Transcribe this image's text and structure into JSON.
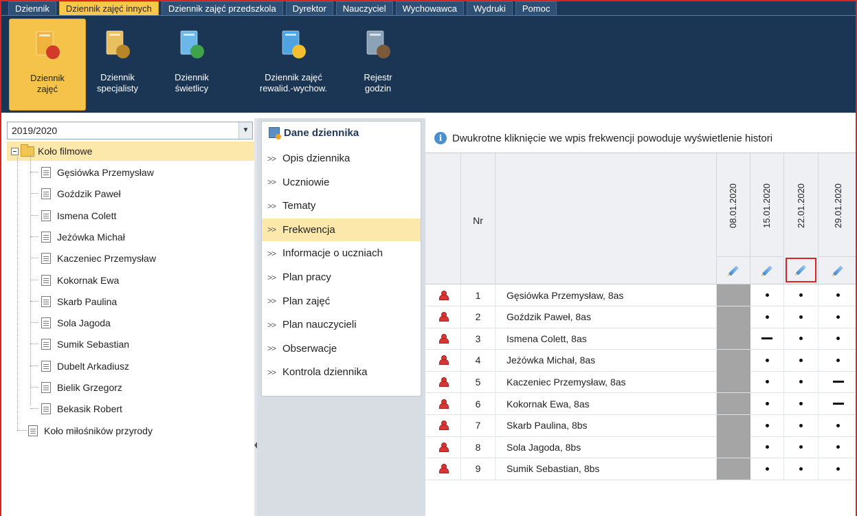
{
  "menu": {
    "tabs": [
      {
        "label": "Dziennik",
        "active": false
      },
      {
        "label": "Dziennik zajęć innych",
        "active": true
      },
      {
        "label": "Dziennik zajęć przedszkola",
        "active": false
      },
      {
        "label": "Dyrektor",
        "active": false
      },
      {
        "label": "Nauczyciel",
        "active": false
      },
      {
        "label": "Wychowawca",
        "active": false
      },
      {
        "label": "Wydruki",
        "active": false
      },
      {
        "label": "Pomoc",
        "active": false
      }
    ]
  },
  "ribbon": {
    "buttons": [
      {
        "label": "Dziennik\nzajęć",
        "icon": "journal-classes-icon",
        "active": true
      },
      {
        "label": "Dziennik\nspecjalisty",
        "icon": "specialist-icon",
        "active": false
      },
      {
        "label": "Dziennik\nświetlicy",
        "icon": "common-room-icon",
        "active": false
      },
      {
        "label": "Dziennik zajęć\nrewalid.-wychow.",
        "icon": "revalidation-icon",
        "active": false
      },
      {
        "label": "Rejestr\ngodzin",
        "icon": "hours-register-icon",
        "active": false
      }
    ]
  },
  "year_select": {
    "value": "2019/2020"
  },
  "tree": {
    "groups": [
      {
        "label": "Koło filmowe",
        "expanded": true,
        "selected": true,
        "children": [
          "Gęsiówka Przemysław",
          "Goździk Paweł",
          "Ismena Colett",
          "Jeżówka Michał",
          "Kaczeniec Przemysław",
          "Kokornak Ewa",
          "Skarb Paulina",
          "Sola Jagoda",
          "Sumik Sebastian",
          "Dubelt Arkadiusz",
          "Bielik Grzegorz",
          "Bekasik Robert"
        ]
      },
      {
        "label": "Koło miłośników przyrody",
        "expanded": false,
        "selected": false,
        "children": []
      }
    ]
  },
  "journal_panel": {
    "title": "Dane dziennika",
    "items": [
      {
        "label": "Opis dziennika",
        "active": false
      },
      {
        "label": "Uczniowie",
        "active": false
      },
      {
        "label": "Tematy",
        "active": false
      },
      {
        "label": "Frekwencja",
        "active": true
      },
      {
        "label": "Informacje o uczniach",
        "active": false
      },
      {
        "label": "Plan pracy",
        "active": false
      },
      {
        "label": "Plan zajęć",
        "active": false
      },
      {
        "label": "Plan nauczycieli",
        "active": false
      },
      {
        "label": "Obserwacje",
        "active": false
      },
      {
        "label": "Kontrola dziennika",
        "active": false
      }
    ]
  },
  "info": {
    "text": "Dwukrotne kliknięcie we wpis frekwencji powoduje wyświetlenie histori"
  },
  "attendance": {
    "nr_header": "Nr",
    "dates": [
      "08.01.2020",
      "15.01.2020",
      "22.01.2020",
      "29.01.2020"
    ],
    "highlighted_date_index": 2,
    "rows": [
      {
        "nr": "1",
        "name": "Gęsiówka Przemysław, 8as",
        "marks": [
          "none",
          "dot",
          "dot",
          "dot"
        ]
      },
      {
        "nr": "2",
        "name": "Goździk Paweł, 8as",
        "marks": [
          "none",
          "dot",
          "dot",
          "dot"
        ]
      },
      {
        "nr": "3",
        "name": "Ismena Colett, 8as",
        "marks": [
          "none",
          "dash",
          "dot",
          "dot"
        ]
      },
      {
        "nr": "4",
        "name": "Jeżówka Michał, 8as",
        "marks": [
          "none",
          "dot",
          "dot",
          "dot"
        ]
      },
      {
        "nr": "5",
        "name": "Kaczeniec Przemysław, 8as",
        "marks": [
          "none",
          "dot",
          "dot",
          "dash"
        ]
      },
      {
        "nr": "6",
        "name": "Kokornak Ewa, 8as",
        "marks": [
          "none",
          "dot",
          "dot",
          "dash"
        ]
      },
      {
        "nr": "7",
        "name": "Skarb Paulina, 8bs",
        "marks": [
          "none",
          "dot",
          "dot",
          "dot"
        ]
      },
      {
        "nr": "8",
        "name": "Sola Jagoda, 8bs",
        "marks": [
          "none",
          "dot",
          "dot",
          "dot"
        ]
      },
      {
        "nr": "9",
        "name": "Sumik Sebastian, 8bs",
        "marks": [
          "none",
          "dot",
          "dot",
          "dot"
        ]
      }
    ]
  },
  "colors": {
    "menu_bg": "#1e3a5a",
    "active_tab": "#f7c84a",
    "selection": "#fde8ab",
    "highlight_border": "#e02020"
  }
}
